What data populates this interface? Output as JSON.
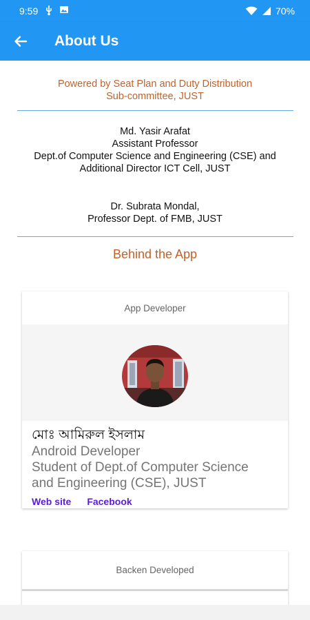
{
  "status_bar": {
    "time": "9:59",
    "battery": "70%"
  },
  "app_bar": {
    "title": "About Us"
  },
  "powered_by": {
    "line1": "Powered by Seat Plan and Duty Distribution",
    "line2": "Sub-committee, JUST"
  },
  "people": [
    {
      "lines": [
        "Md. Yasir Arafat",
        "Assistant Professor",
        "Dept.of Computer Science and Engineering (CSE) and",
        "Additional Director ICT Cell, JUST"
      ]
    },
    {
      "lines": [
        "Dr. Subrata Mondal,",
        "Professor Dept. of FMB, JUST"
      ]
    }
  ],
  "behind_title": "Behind the App",
  "developer_card": {
    "header": "App Developer",
    "name": "মোঃ আমিরুল ইসলাম",
    "desc_line1": "Android Developer",
    "desc_line2": "Student of Dept.of Computer Science",
    "desc_line3": "and Engineering (CSE), JUST",
    "link_website": "Web site",
    "link_facebook": "Facebook"
  },
  "backend_card": {
    "header": "Backen Developed"
  },
  "colors": {
    "primary": "#2196f3",
    "accent_text": "#c0622a",
    "link": "#5b1bd6"
  }
}
